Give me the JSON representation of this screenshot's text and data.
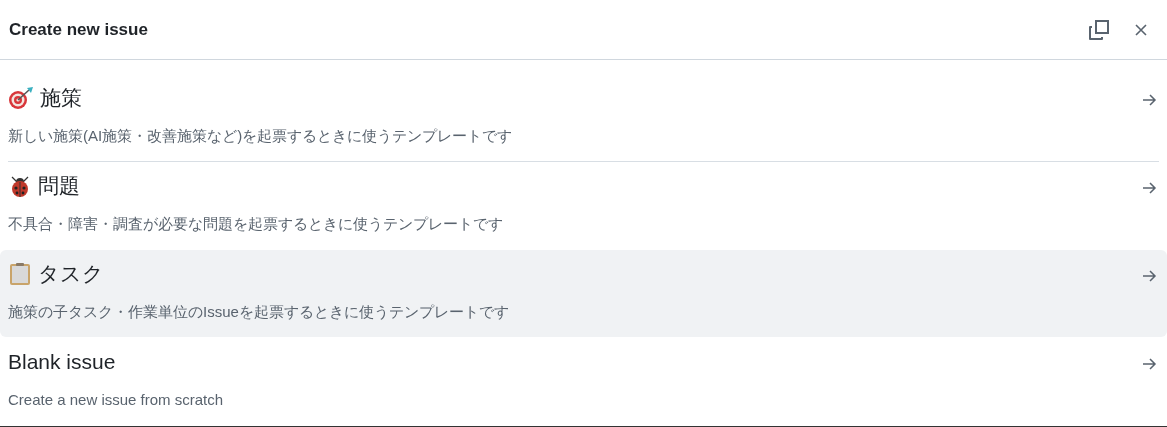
{
  "dialog": {
    "title": "Create new issue"
  },
  "templates": [
    {
      "kind": "target",
      "title": "施策",
      "description": "新しい施策(AI施策・改善施策など)を起票するときに使うテンプレートです",
      "selected": false
    },
    {
      "kind": "ladybug",
      "title": "問題",
      "description": "不具合・障害・調査が必要な問題を起票するときに使うテンプレートです",
      "selected": false
    },
    {
      "kind": "clipboard",
      "title": "タスク",
      "description": "施策の子タスク・作業単位のIssueを起票するときに使うテンプレートです",
      "selected": true
    },
    {
      "kind": "blank",
      "title": "Blank issue",
      "description": "Create a new issue from scratch",
      "selected": false
    }
  ]
}
